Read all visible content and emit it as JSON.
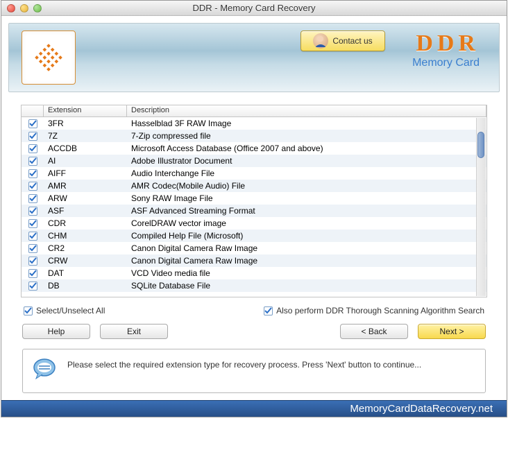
{
  "window": {
    "title": "DDR - Memory Card Recovery"
  },
  "header": {
    "contact_label": "Contact us",
    "brand_main": "DDR",
    "brand_sub": "Memory Card"
  },
  "table": {
    "columns": {
      "extension": "Extension",
      "description": "Description"
    },
    "rows": [
      {
        "ext": "3FR",
        "desc": "Hasselblad 3F RAW Image",
        "checked": true
      },
      {
        "ext": "7Z",
        "desc": "7-Zip compressed file",
        "checked": true
      },
      {
        "ext": "ACCDB",
        "desc": "Microsoft Access Database (Office 2007 and above)",
        "checked": true
      },
      {
        "ext": "AI",
        "desc": "Adobe Illustrator Document",
        "checked": true
      },
      {
        "ext": "AIFF",
        "desc": "Audio Interchange File",
        "checked": true
      },
      {
        "ext": "AMR",
        "desc": "AMR Codec(Mobile Audio) File",
        "checked": true
      },
      {
        "ext": "ARW",
        "desc": "Sony RAW Image File",
        "checked": true
      },
      {
        "ext": "ASF",
        "desc": "ASF Advanced Streaming Format",
        "checked": true
      },
      {
        "ext": "CDR",
        "desc": "CorelDRAW vector image",
        "checked": true
      },
      {
        "ext": "CHM",
        "desc": "Compiled Help File (Microsoft)",
        "checked": true
      },
      {
        "ext": "CR2",
        "desc": "Canon Digital Camera Raw Image",
        "checked": true
      },
      {
        "ext": "CRW",
        "desc": "Canon Digital Camera Raw Image",
        "checked": true
      },
      {
        "ext": "DAT",
        "desc": "VCD Video media file",
        "checked": true
      },
      {
        "ext": "DB",
        "desc": "SQLite Database File",
        "checked": true
      }
    ]
  },
  "options": {
    "select_all": "Select/Unselect All",
    "thorough_scan": "Also perform DDR Thorough Scanning Algorithm Search"
  },
  "buttons": {
    "help": "Help",
    "exit": "Exit",
    "back": "< Back",
    "next": "Next >"
  },
  "info": {
    "text": "Please select the required extension type for recovery process. Press 'Next' button to continue..."
  },
  "footer": {
    "url": "MemoryCardDataRecovery.net"
  }
}
